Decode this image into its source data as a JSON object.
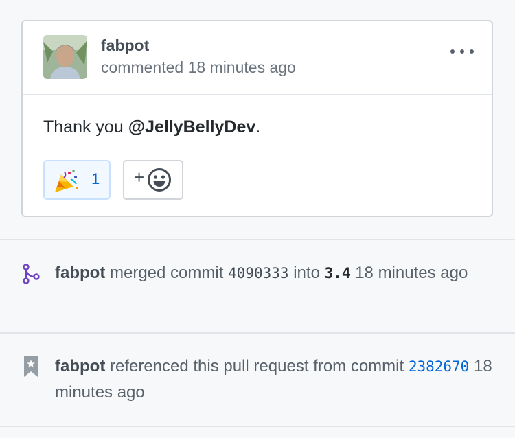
{
  "comment": {
    "author": "fabpot",
    "action": "commented",
    "time": "18 minutes ago",
    "body_prefix": "Thank you ",
    "mention": "@JellyBellyDev",
    "body_suffix": ".",
    "reactions": [
      {
        "emoji_icon": "party-popper-icon",
        "count": "1"
      }
    ],
    "add_reaction_label": "+"
  },
  "events": [
    {
      "type": "merge",
      "icon": "git-merge-icon",
      "actor": "fabpot",
      "verb": "merged commit",
      "commit": "4090333",
      "preposition": "into",
      "branch": "3.4",
      "time": "18 minutes ago",
      "icon_color": "#6f42c1"
    },
    {
      "type": "reference",
      "icon": "bookmark-icon",
      "actor": "fabpot",
      "verb": "referenced this pull request from commit",
      "commit": "2382670",
      "time": "18 minutes ago",
      "icon_color": "#959da5"
    }
  ],
  "colors": {
    "link_blue": "#0366d6",
    "reaction_bg": "#f1f8ff",
    "border": "#d1d5da"
  }
}
